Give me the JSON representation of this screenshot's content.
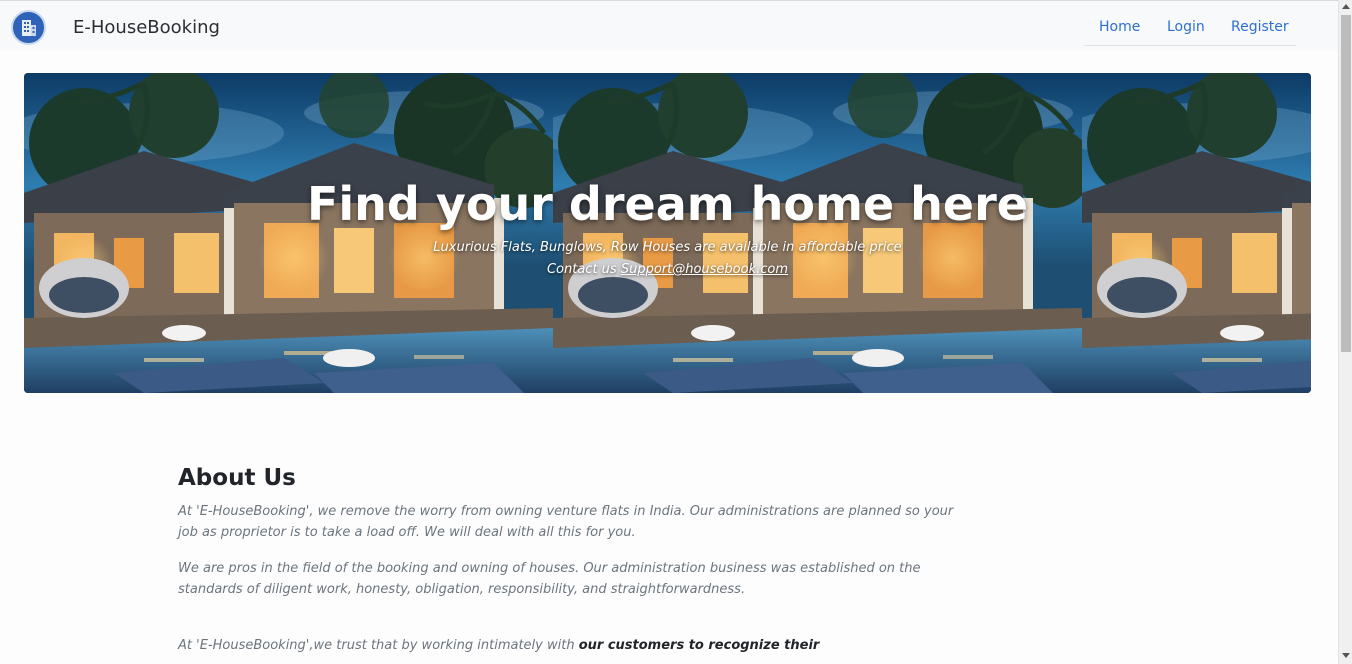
{
  "navbar": {
    "brand": "E-HouseBooking",
    "links": [
      {
        "label": "Home"
      },
      {
        "label": "Login"
      },
      {
        "label": "Register"
      }
    ]
  },
  "hero": {
    "title": "Find your dream home here",
    "subtitle": "Luxurious Flats, Bunglows, Row Houses are available in affordable price",
    "contact_prefix": "Contact us ",
    "contact_email": "Support@housebook.com"
  },
  "about": {
    "title": "About Us",
    "p1": "At 'E-HouseBooking', we remove the worry from owning venture flats in India. Our administrations are planned so your job as proprietor is to take a load off. We will deal with all this for you.",
    "p2": "We are pros in the field of the booking and owning of houses. Our administration business was established on the standards of diligent work, honesty, obligation, responsibility, and straightforwardness.",
    "p3_prefix": "At 'E-HouseBooking',we trust that by working intimately with ",
    "p3_bold": "our customers to recognize their"
  },
  "colors": {
    "link": "#2e6fd6",
    "navbar_bg": "#f8f9fa",
    "logo": "#2f63b8"
  }
}
